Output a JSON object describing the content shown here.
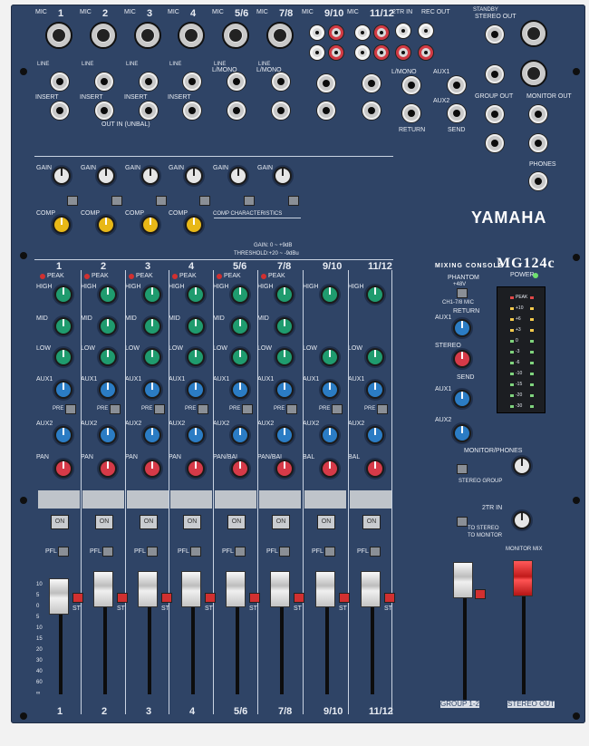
{
  "image": {
    "description_alt": "Yamaha MG124c mixing console top panel"
  },
  "brand": {
    "logo": "YAMAHA",
    "subtitle": "MIXING CONSOLE",
    "model": "MG124c"
  },
  "channels": [
    "1",
    "2",
    "3",
    "4",
    "5/6",
    "7/8",
    "9/10",
    "11/12"
  ],
  "input_labels": {
    "mic": "MIC",
    "line": "LINE",
    "insert": "INSERT",
    "lmono": "L/MONO",
    "out_in": "OUT IN (UNBAL)",
    "tr_in": "2TR IN",
    "rec_out": "REC OUT",
    "standby": "STANDBY",
    "stereo_out": "STEREO OUT",
    "aux1": "AUX1",
    "aux2": "AUX2",
    "return": "RETURN",
    "send": "SEND",
    "group_out": "GROUP OUT",
    "monitor_out": "MONITOR OUT",
    "phones": "PHONES"
  },
  "channel_controls": {
    "gain": "GAIN",
    "comp": "COMP",
    "comp_char": "COMP CHARACTERISTICS",
    "gain_text": "GAIN:  0 ~ +9dB",
    "threshold_text": "THRESHOLD:+20 ~ -9dBu",
    "peak": "PEAK",
    "high": "HIGH",
    "mid": "MID",
    "low": "LOW",
    "aux1": "AUX1",
    "aux2": "AUX2",
    "pan": "PAN",
    "bal": "BAL",
    "pan_bal": "PAN/BAL",
    "pre": "PRE",
    "on": "ON",
    "pfl": "PFL",
    "st": "ST"
  },
  "master": {
    "phantom": "PHANTOM",
    "phantom_v": "+48V",
    "phantom_ch": "CH1-7/8 MIC",
    "return": "RETURN",
    "aux1": "AUX1",
    "stereo": "STEREO",
    "send": "SEND",
    "aux2": "AUX2",
    "power": "POWER",
    "monitor_phones": "MONITOR/PHONES",
    "stereo_group": "STEREO GROUP",
    "tr_in": "2TR IN",
    "to_stereo": "TO STEREO",
    "to_monitor": "TO MONITOR",
    "monitor_mix": "MONITOR MIX",
    "group_label": "GROUP 1-2",
    "stereo_out_label": "STEREO OUT"
  },
  "meter_scale": [
    "PEAK",
    "+10",
    "+6",
    "+3",
    "0",
    "-3",
    "-6",
    "-10",
    "-15",
    "-20",
    "-30"
  ],
  "fader_scale": [
    "10",
    "5",
    "0",
    "5",
    "10",
    "15",
    "20",
    "30",
    "40",
    "60",
    "∞"
  ],
  "colors": {
    "panel": "#2f4466",
    "eq_knob": "#1f9b6e",
    "aux_knob": "#2b7cc4",
    "pan_knob": "#d63a48",
    "comp_knob": "#e8b817"
  }
}
